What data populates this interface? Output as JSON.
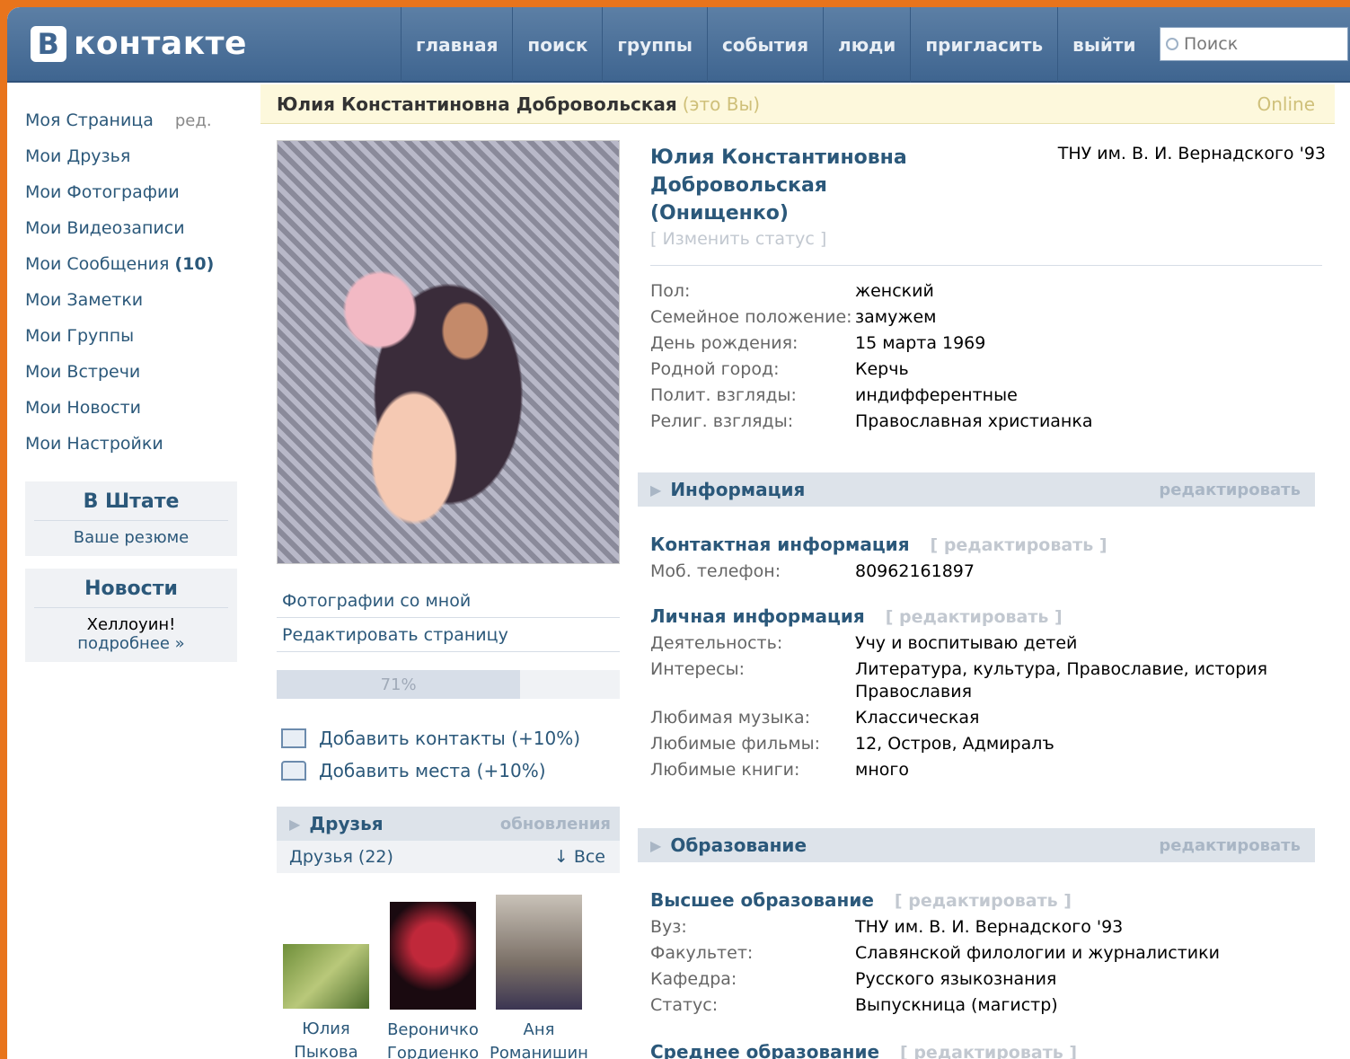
{
  "header": {
    "logo_letter": "В",
    "logo_text": "контакте",
    "nav": [
      "главная",
      "поиск",
      "группы",
      "события",
      "люди",
      "пригласить",
      "выйти"
    ],
    "search_placeholder": "Поиск"
  },
  "left_menu": {
    "items": [
      "Моя Страница",
      "Мои Друзья",
      "Мои Фотографии",
      "Мои Видеозаписи",
      "Мои Сообщения",
      "Мои Заметки",
      "Мои Группы",
      "Мои Встречи",
      "Мои Новости",
      "Мои Настройки"
    ],
    "edit_label": "ред.",
    "messages_count": "(10)",
    "box1_title": "В Штате",
    "box1_link": "Ваше резюме",
    "box2_title": "Новости",
    "box2_text": "Хеллоуин!",
    "box2_link": "подробнее »"
  },
  "profile_bar": {
    "name": "Юлия Константиновна Добровольская",
    "you": "(это Вы)",
    "online": "Online"
  },
  "photo_links": [
    "Фотографии со мной",
    "Редактировать страницу"
  ],
  "progress": {
    "percent": 71,
    "label": "71%"
  },
  "add_items": [
    "Добавить контакты (+10%)",
    "Добавить места (+10%)"
  ],
  "friends": {
    "title": "Друзья",
    "updates": "обновления",
    "count_label": "Друзья (22)",
    "all_label": "↓ Все",
    "list": [
      {
        "first": "Юлия",
        "last": "Пыкова"
      },
      {
        "first": "Вероничко",
        "last": "Гордиенко"
      },
      {
        "first": "Аня",
        "last": "Романишин"
      }
    ]
  },
  "info": {
    "fullname": "Юлия Константиновна Добровольская (Онищенко)",
    "university": "ТНУ им. В. И. Вернадского '93",
    "status_edit": "[ Изменить статус ]",
    "basic": [
      {
        "label": "Пол:",
        "value": "женский"
      },
      {
        "label": "Семейное положение:",
        "value": "замужем"
      },
      {
        "label": "День рождения:",
        "value": "15 марта 1969"
      },
      {
        "label": "Родной город:",
        "value": "Керчь"
      },
      {
        "label": "Полит. взгляды:",
        "value": "индифферентные"
      },
      {
        "label": "Религ. взгляды:",
        "value": "Православная христианка"
      }
    ],
    "section_info": "Информация",
    "section_edit": "редактировать",
    "contact_title": "Контактная информация",
    "sub_edit": "[ редактировать ]",
    "contact": [
      {
        "label": "Моб. телефон:",
        "value": "80962161897"
      }
    ],
    "personal_title": "Личная информация",
    "personal": [
      {
        "label": "Деятельность:",
        "value": "Учу и воспитываю детей"
      },
      {
        "label": "Интересы:",
        "value": "Литература, культура, Православие, история Православия"
      },
      {
        "label": "Любимая музыка:",
        "value": "Классическая"
      },
      {
        "label": "Любимые фильмы:",
        "value": "12, Остров, Адмиралъ"
      },
      {
        "label": "Любимые книги:",
        "value": "много"
      }
    ],
    "section_education": "Образование",
    "higher_title": "Высшее образование",
    "higher": [
      {
        "label": "Вуз:",
        "value": "ТНУ им. В. И. Вернадского '93"
      },
      {
        "label": "Факультет:",
        "value": "Славянской филологии и журналистики"
      },
      {
        "label": "Кафедра:",
        "value": "Русского языкознания"
      },
      {
        "label": "Статус:",
        "value": "Выпускница (магистр)"
      }
    ],
    "secondary_title": "Среднее образование"
  }
}
